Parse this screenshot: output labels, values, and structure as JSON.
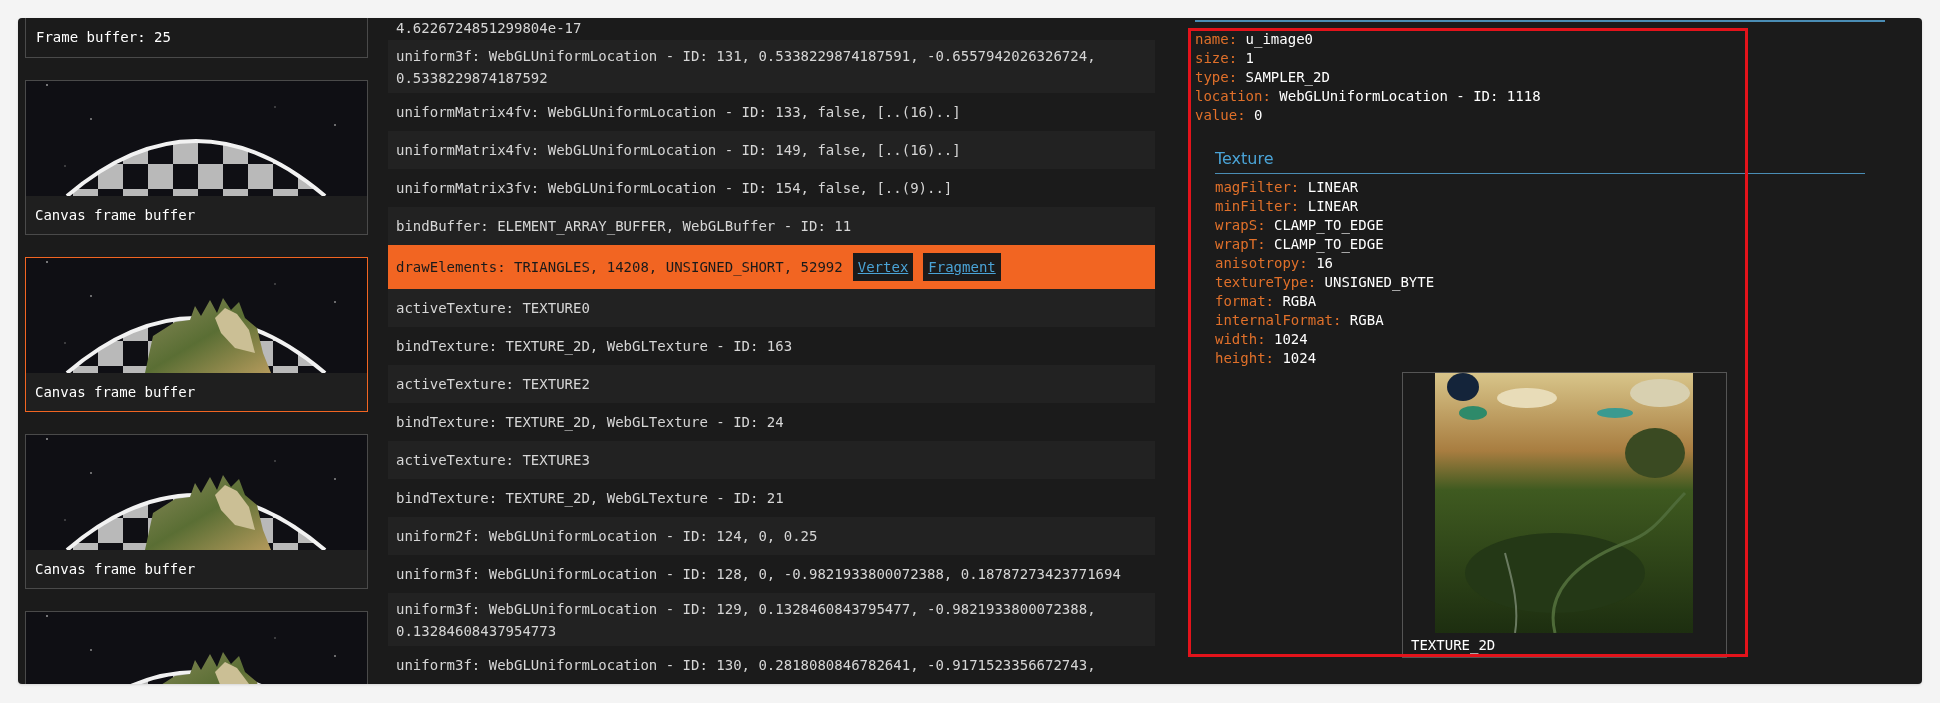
{
  "frame_buffer": {
    "label": "Frame buffer: 25"
  },
  "thumbnails": [
    {
      "label": "Canvas frame buffer",
      "selected": false
    },
    {
      "label": "Canvas frame buffer",
      "selected": true
    },
    {
      "label": "Canvas frame buffer",
      "selected": false
    },
    {
      "selected": false
    }
  ],
  "calls": [
    {
      "text": "4.6226724851299804e-17",
      "selected": false
    },
    {
      "text": "uniform3f: WebGLUniformLocation - ID: 131, 0.5338229874187591, -0.6557942026326724, 0.5338229874187592",
      "selected": false
    },
    {
      "text": "uniformMatrix4fv: WebGLUniformLocation - ID: 133, false, [..(16)..]",
      "selected": false
    },
    {
      "text": "uniformMatrix4fv: WebGLUniformLocation - ID: 149, false, [..(16)..]",
      "selected": false
    },
    {
      "text": "uniformMatrix3fv: WebGLUniformLocation - ID: 154, false, [..(9)..]",
      "selected": false
    },
    {
      "text": "bindBuffer: ELEMENT_ARRAY_BUFFER, WebGLBuffer - ID: 11",
      "selected": false
    },
    {
      "text": "drawElements: TRIANGLES, 14208, UNSIGNED_SHORT, 52992",
      "selected": true,
      "links": [
        "Vertex",
        "Fragment"
      ]
    },
    {
      "text": "activeTexture: TEXTURE0",
      "selected": false
    },
    {
      "text": "bindTexture: TEXTURE_2D, WebGLTexture - ID: 163",
      "selected": false
    },
    {
      "text": "activeTexture: TEXTURE2",
      "selected": false
    },
    {
      "text": "bindTexture: TEXTURE_2D, WebGLTexture - ID: 24",
      "selected": false
    },
    {
      "text": "activeTexture: TEXTURE3",
      "selected": false
    },
    {
      "text": "bindTexture: TEXTURE_2D, WebGLTexture - ID: 21",
      "selected": false
    },
    {
      "text": "uniform2f: WebGLUniformLocation - ID: 124, 0, 0.25",
      "selected": false
    },
    {
      "text": "uniform3f: WebGLUniformLocation - ID: 128, 0, -0.9821933800072388, 0.18787273423771694",
      "selected": false
    },
    {
      "text": "uniform3f: WebGLUniformLocation - ID: 129, 0.1328460843795477, -0.9821933800072388, 0.13284608437954773",
      "selected": false
    },
    {
      "text": "uniform3f: WebGLUniformLocation - ID: 130, 0.2818080846782641, -0.9171523356672743,",
      "selected": false
    }
  ],
  "uniform": [
    {
      "key": "name:",
      "value": "u_image0"
    },
    {
      "key": "size:",
      "value": "1"
    },
    {
      "key": "type:",
      "value": "SAMPLER_2D"
    },
    {
      "key": "location:",
      "value": "WebGLUniformLocation - ID: 1118"
    },
    {
      "key": "value:",
      "value": "0"
    }
  ],
  "texture": {
    "title": "Texture",
    "properties": [
      {
        "key": "magFilter:",
        "value": "LINEAR"
      },
      {
        "key": "minFilter:",
        "value": "LINEAR"
      },
      {
        "key": "wrapS:",
        "value": "CLAMP_TO_EDGE"
      },
      {
        "key": "wrapT:",
        "value": "CLAMP_TO_EDGE"
      },
      {
        "key": "anisotropy:",
        "value": "16"
      },
      {
        "key": "textureType:",
        "value": "UNSIGNED_BYTE"
      },
      {
        "key": "format:",
        "value": "RGBA"
      },
      {
        "key": "internalFormat:",
        "value": "RGBA"
      },
      {
        "key": "width:",
        "value": "1024"
      },
      {
        "key": "height:",
        "value": "1024"
      }
    ],
    "preview": {
      "kind": "picture",
      "label": "TEXTURE_2D"
    }
  }
}
